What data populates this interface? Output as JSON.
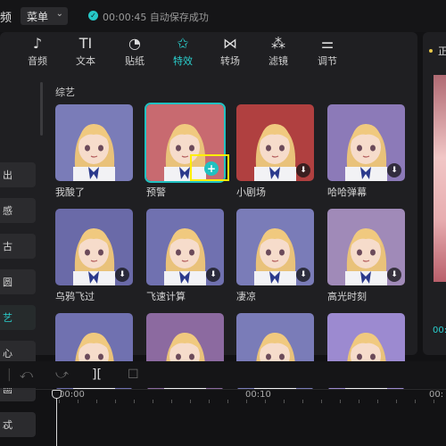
{
  "topbar": {
    "app_title_fragment": "频",
    "menu_label": "菜单",
    "menu_chevron": "chevron-down-icon",
    "save_status": "00:00:45 自动保存成功"
  },
  "tabs": [
    {
      "label": "音频",
      "icon": "audio-icon",
      "glyph": "♪",
      "active": false
    },
    {
      "label": "文本",
      "icon": "text-icon",
      "glyph": "TI",
      "active": false
    },
    {
      "label": "贴纸",
      "icon": "sticker-icon",
      "glyph": "◔",
      "active": false
    },
    {
      "label": "特效",
      "icon": "effects-icon",
      "glyph": "✩",
      "active": true
    },
    {
      "label": "转场",
      "icon": "transition-icon",
      "glyph": "⋈",
      "active": false
    },
    {
      "label": "滤镜",
      "icon": "filter-icon",
      "glyph": "⁂",
      "active": false
    },
    {
      "label": "调节",
      "icon": "adjust-icon",
      "glyph": "⚌",
      "active": false
    }
  ],
  "categories": [
    {
      "label": "出",
      "active": false
    },
    {
      "label": "感",
      "active": false
    },
    {
      "label": "古",
      "active": false
    },
    {
      "label": "圆",
      "active": false
    },
    {
      "label": "艺",
      "active": true
    },
    {
      "label": "心",
      "active": false
    },
    {
      "label": "画",
      "active": false
    },
    {
      "label": "忒",
      "active": false
    }
  ],
  "section_title": "综艺",
  "effects": [
    {
      "name": "我酸了",
      "downloaded": true,
      "selected": false
    },
    {
      "name": "预警",
      "downloaded": true,
      "selected": true
    },
    {
      "name": "小剧场",
      "downloaded": false,
      "selected": false
    },
    {
      "name": "哈哈弹幕",
      "downloaded": false,
      "selected": false
    },
    {
      "name": "乌鸦飞过",
      "downloaded": false,
      "selected": false
    },
    {
      "name": "飞速计算",
      "downloaded": false,
      "selected": false
    },
    {
      "name": "凄凉",
      "downloaded": false,
      "selected": false
    },
    {
      "name": "高光时刻",
      "downloaded": false,
      "selected": false
    },
    {
      "name": "",
      "downloaded": false,
      "selected": false
    },
    {
      "name": "",
      "downloaded": false,
      "selected": false
    },
    {
      "name": "",
      "downloaded": false,
      "selected": false
    },
    {
      "name": "",
      "downloaded": false,
      "selected": false
    }
  ],
  "add_button_glyph": "+",
  "download_glyph": "⬇",
  "preview": {
    "label": "正",
    "time": "00:"
  },
  "timeline": {
    "undo": "⤺",
    "redo": "⤻",
    "split": "][",
    "delete": "☐",
    "marks": [
      "00:00",
      "00:10",
      "00:"
    ]
  },
  "colors": {
    "accent": "#2ad0cf",
    "highlight": "#ffee00",
    "panel": "#1f1f22"
  }
}
